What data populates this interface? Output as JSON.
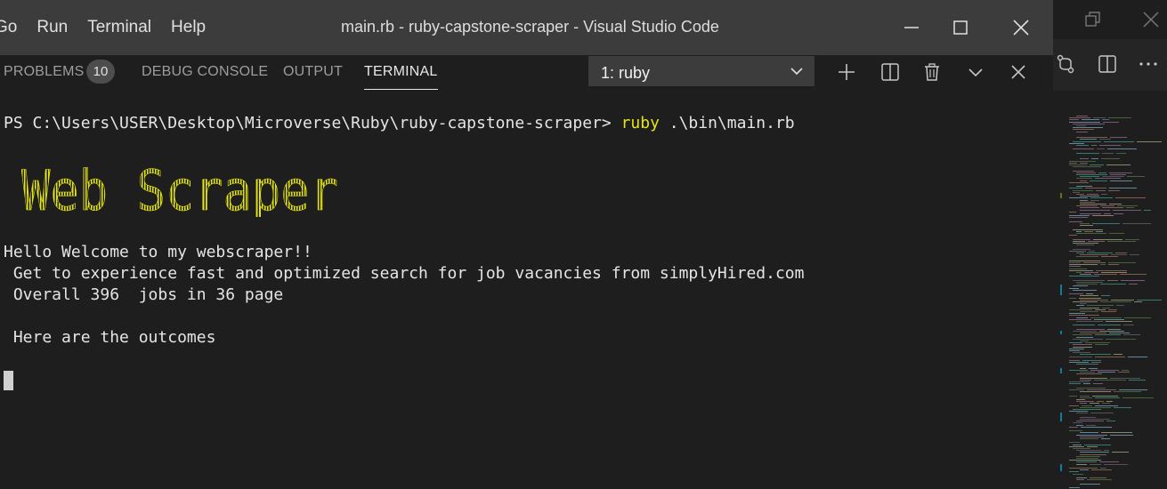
{
  "menu": [
    "Go",
    "Run",
    "Terminal",
    "Help"
  ],
  "window_title": "main.rb - ruby-capstone-scraper - Visual Studio Code",
  "panel": {
    "tabs": [
      {
        "label": "PROBLEMS",
        "badge": "10"
      },
      {
        "label": "DEBUG CONSOLE"
      },
      {
        "label": "OUTPUT"
      },
      {
        "label": "TERMINAL",
        "active": true
      }
    ],
    "terminal_select": "1: ruby"
  },
  "terminal": {
    "prompt": "PS C:\\Users\\USER\\Desktop\\Microverse\\Ruby\\ruby-capstone-scraper> ",
    "command": "ruby",
    "args": " .\\bin\\main.rb",
    "banner": "Web Scraper",
    "lines": [
      "Hello Welcome to my webscraper!!",
      " Get to experience fast and optimized search for job vacancies from simplyHired.com",
      " Overall 396  jobs in 36 page",
      "",
      " Here are the outcomes"
    ]
  },
  "colors": {
    "titlebar": "#3c3c3c",
    "terminal_bg": "#1e1e1e",
    "command_yellow": "#e5e510",
    "banner_yellow": "#e5e510"
  },
  "icons": [
    "maximize-icon",
    "minimize-icon",
    "restore-icon",
    "close-icon",
    "add-terminal-icon",
    "split-terminal-icon",
    "trash-icon",
    "chevron-down-icon",
    "close-panel-icon",
    "compare-icon",
    "split-editor-icon",
    "more-actions-icon"
  ]
}
